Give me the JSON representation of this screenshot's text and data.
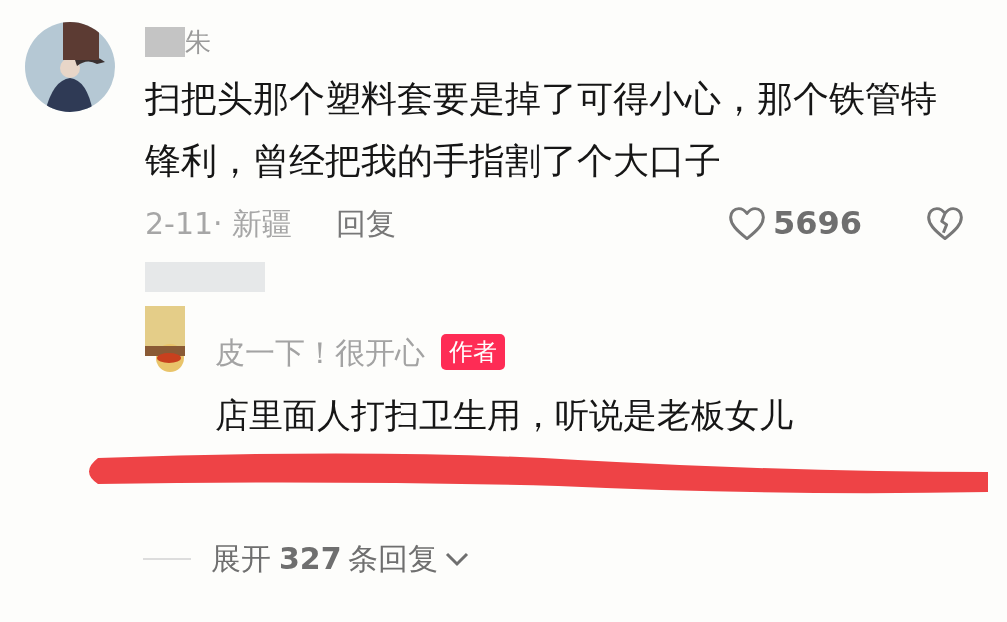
{
  "comment": {
    "author": "朱",
    "text": "扫把头那个塑料套要是掉了可得小心，那个铁管特锋利，曾经把我的手指割了个大口子",
    "date_location": "2-11· 新疆",
    "reply_label": "回复",
    "likes": "5696",
    "liked": false
  },
  "reply": {
    "author": "皮一下！很开心",
    "badge": "作者",
    "text": "店里面人打扫卫生用，听说是老板女儿"
  },
  "expand": {
    "label": "展开",
    "count": "327",
    "suffix": "条回复"
  }
}
